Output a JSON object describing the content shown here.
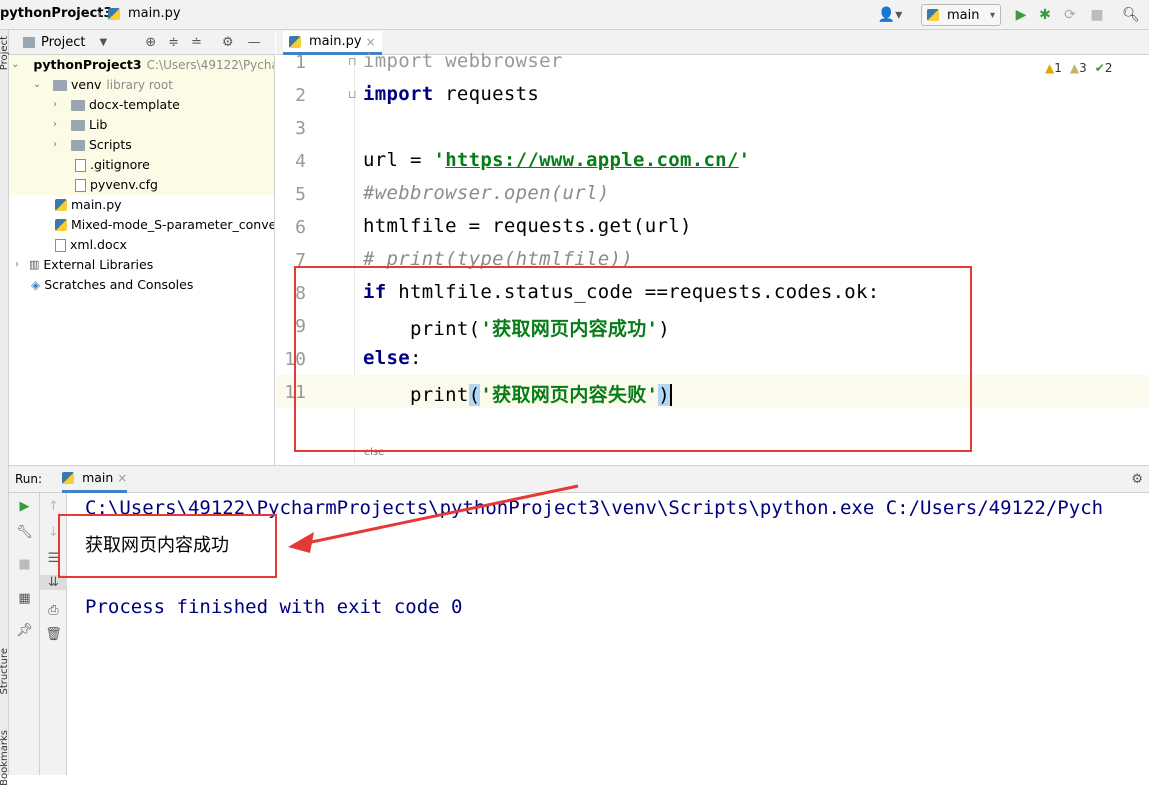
{
  "breadcrumb": {
    "project": "pythonProject3",
    "file": "main.py"
  },
  "toolbar": {
    "run_config": "main"
  },
  "project_panel": {
    "title": "Project",
    "root": {
      "name": "pythonProject3",
      "path": "C:\\Users\\49122\\Pycha"
    },
    "venv": {
      "name": "venv",
      "tag": "library root"
    },
    "items": [
      "docx-template",
      "Lib",
      "Scripts",
      ".gitignore",
      "pyvenv.cfg"
    ],
    "files": [
      "main.py",
      "Mixed-mode_S-parameter_conversi",
      "xml.docx"
    ],
    "external": "External Libraries",
    "scratches": "Scratches and Consoles"
  },
  "editor": {
    "tab": "main.py",
    "line_numbers": [
      "1",
      "2",
      "3",
      "4",
      "5",
      "6",
      "7",
      "8",
      "9",
      "10",
      "11"
    ],
    "inspections": {
      "warnings": "1",
      "weak": "3",
      "typos": "2"
    },
    "line1": "import webbrowser",
    "line2_kw": "import",
    "line2_rest": " requests",
    "line4_a": "url = ",
    "line4_q1": "'",
    "line4_url": "https://www.apple.com.cn/",
    "line4_q2": "'",
    "line5": "#webbrowser.open(url)",
    "line6": "htmlfile = requests.get(url)",
    "line7": "# print(type(htmlfile))",
    "line8_kw": "if",
    "line8_rest": " htmlfile.status_code ==requests.codes.ok:",
    "line9_a": "    print(",
    "line9_str": "'获取网页内容成功'",
    "line9_b": ")",
    "line10_kw": "else",
    "line10_b": ":",
    "line11_a": "    print",
    "line11_p1": "(",
    "line11_str": "'获取网页内容失败'",
    "line11_p2": ")",
    "footer_crumb": "else"
  },
  "run_panel": {
    "label": "Run:",
    "tab": "main",
    "cmd": "C:\\Users\\49122\\PycharmProjects\\pythonProject3\\venv\\Scripts\\python.exe C:/Users/49122/Pych",
    "output": "获取网页内容成功",
    "exit": "Process finished with exit code 0"
  },
  "side_labels": {
    "project": "Project",
    "structure": "Structure",
    "bookmarks": "Bookmarks"
  },
  "colors": {
    "keyword": "#000080",
    "string": "#067d17",
    "comment": "#8c8c8c",
    "annotation": "#e53935"
  }
}
